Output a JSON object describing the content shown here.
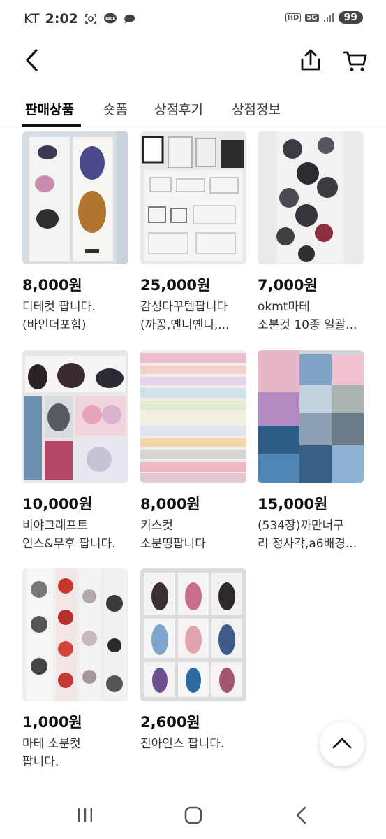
{
  "status_bar": {
    "carrier": "KT",
    "time": "2:02",
    "hd": "HD",
    "network": "5G",
    "battery": "99",
    "talk_badge": "TALK"
  },
  "header": {
    "back_icon": "chevron-left-icon",
    "share_icon": "share-icon",
    "cart_icon": "cart-icon"
  },
  "tabs": [
    {
      "label": "판매상품",
      "active": true
    },
    {
      "label": "숏폼",
      "active": false
    },
    {
      "label": "상점후기",
      "active": false
    },
    {
      "label": "상점정보",
      "active": false
    }
  ],
  "products": [
    {
      "price": "8,000원",
      "title": [
        "디테컷 팝니다.",
        "(바인더포함)"
      ]
    },
    {
      "price": "25,000원",
      "title": [
        "감성다꾸템팝니다",
        "(까꽁,옌니옌니,..."
      ]
    },
    {
      "price": "7,000원",
      "title": [
        "okmt마테",
        "소분컷 10종 일괄..."
      ]
    },
    {
      "price": "10,000원",
      "title": [
        "비야크래프트",
        "인스&무후 팝니다."
      ]
    },
    {
      "price": "8,000원",
      "title": [
        "키스컷",
        "소분띵팝니다"
      ]
    },
    {
      "price": "15,000원",
      "title": [
        "(534장)까만너구",
        "리 정사각,a6배경..."
      ]
    },
    {
      "price": "1,000원",
      "title": [
        "마테 소분컷",
        "팝니다."
      ]
    },
    {
      "price": "2,600원",
      "title": [
        "진아인스 팝니다."
      ]
    }
  ],
  "scroll_top_icon": "chevron-up-icon",
  "navbar": {
    "recent_icon": "recent-apps-icon",
    "home_icon": "home-icon",
    "back_icon": "back-icon"
  }
}
